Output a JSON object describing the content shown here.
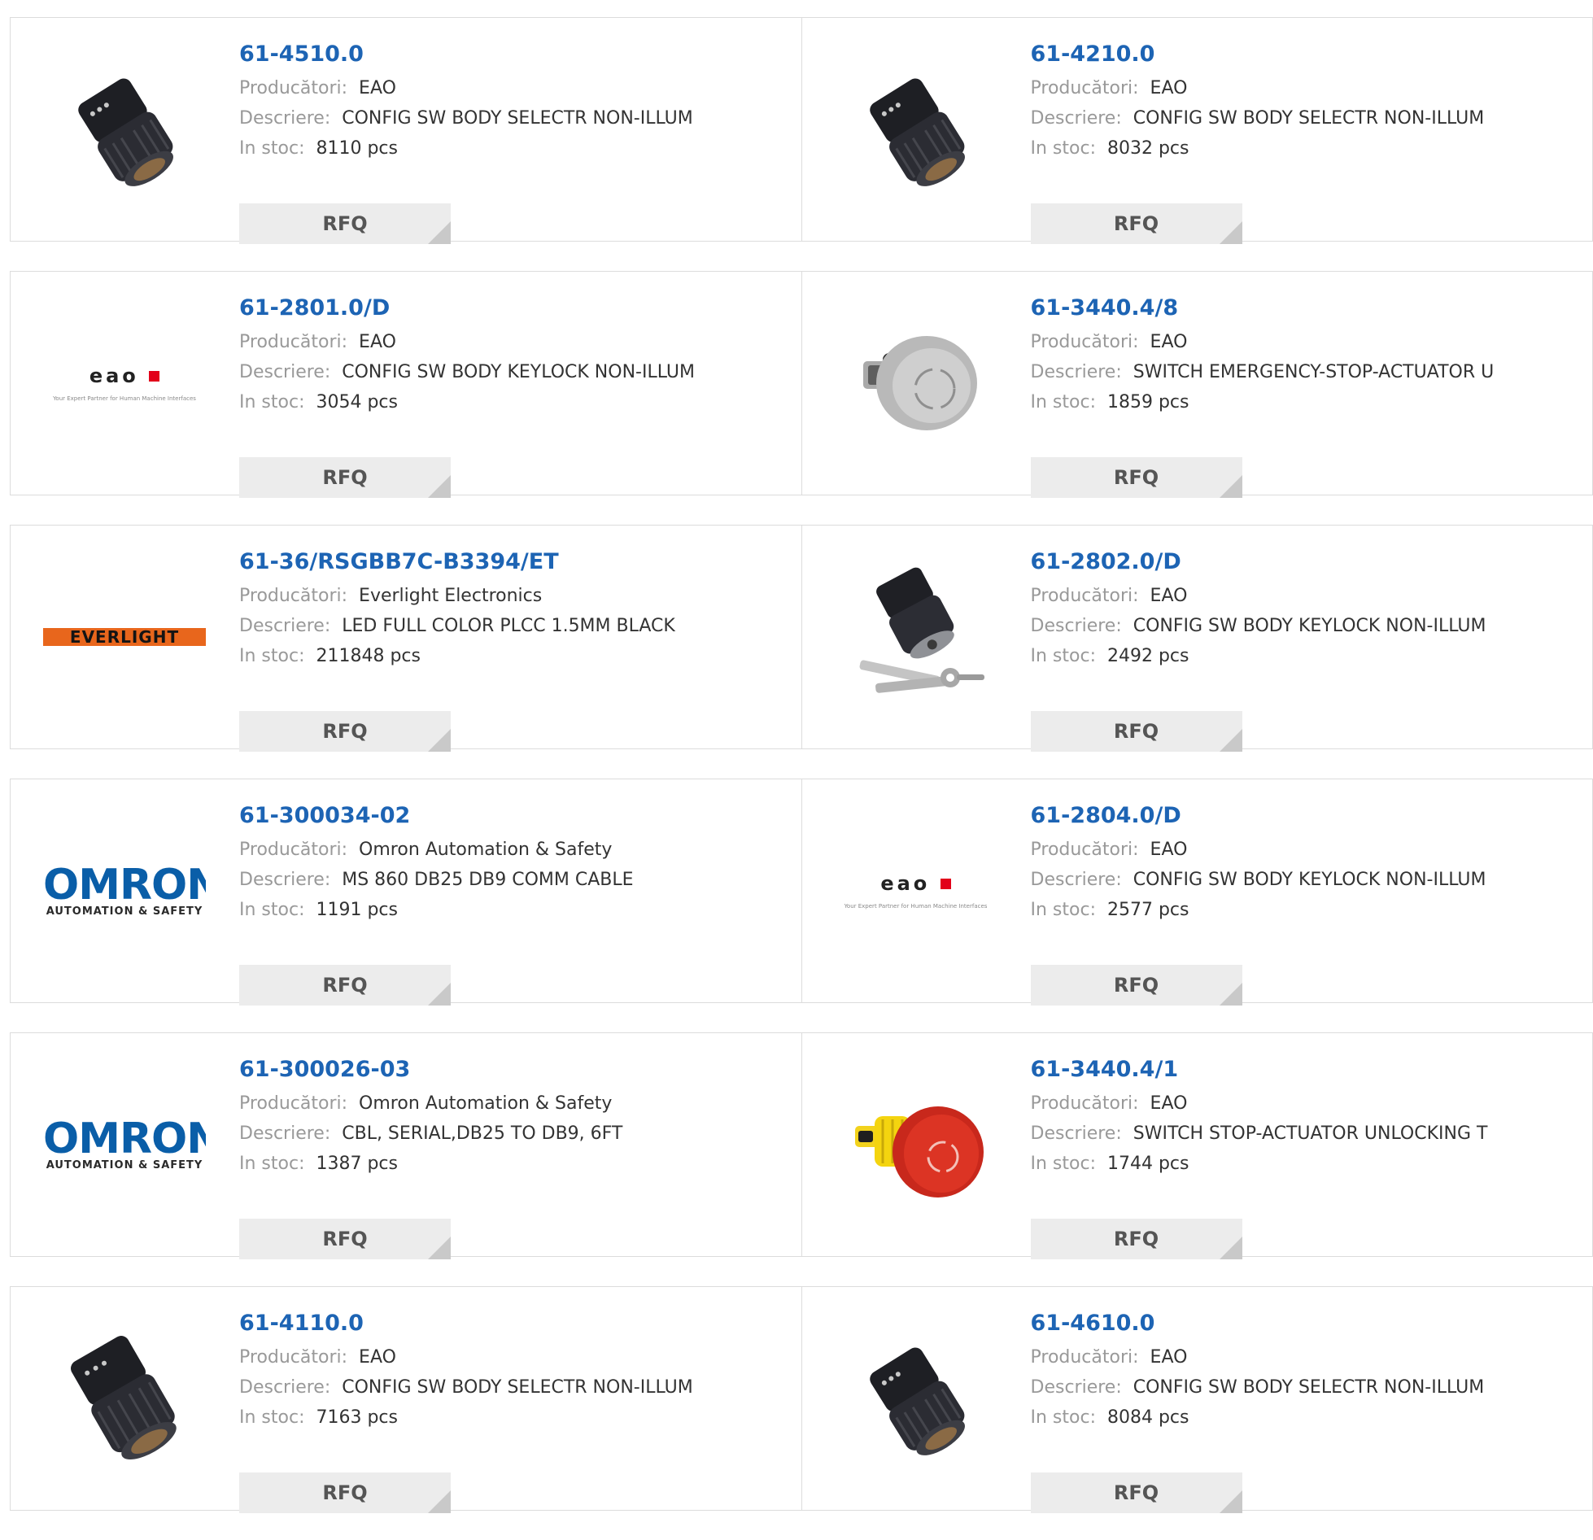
{
  "labels": {
    "manufacturer": "Producători:",
    "description": "Descriere:",
    "stock": "In stoc:",
    "rfq": "RFQ"
  },
  "colors": {
    "link": "#1d64b4",
    "label": "#999999",
    "value": "#333333",
    "button_bg": "#ececec",
    "border": "#dcdcdc"
  },
  "logos": {
    "eao": {
      "word": "eao",
      "tagline": "Your Expert Partner for Human Machine Interfaces"
    },
    "omron": {
      "word": "OMRON",
      "sub": "AUTOMATION & SAFETY"
    },
    "everlight": {
      "word": "EVERLIGHT"
    }
  },
  "products": [
    {
      "part": "61-4510.0",
      "manufacturer": "EAO",
      "description": "CONFIG SW BODY SELECTR NON-ILLUM",
      "stock": "8110 pcs",
      "image": "selector-switch-body-photo"
    },
    {
      "part": "61-4210.0",
      "manufacturer": "EAO",
      "description": "CONFIG SW BODY SELECTR NON-ILLUM",
      "stock": "8032 pcs",
      "image": "selector-switch-body-photo"
    },
    {
      "part": "61-2801.0/D",
      "manufacturer": "EAO",
      "description": "CONFIG SW BODY KEYLOCK NON-ILLUM",
      "stock": "3054 pcs",
      "image": "eao-logo"
    },
    {
      "part": "61-3440.4/8",
      "manufacturer": "EAO",
      "description": "SWITCH EMERGENCY-STOP-ACTUATOR U",
      "stock": "1859 pcs",
      "image": "grey-stop-actuator-photo"
    },
    {
      "part": "61-36/RSGBB7C-B3394/ET",
      "manufacturer": "Everlight Electronics",
      "description": "LED FULL COLOR PLCC 1.5MM BLACK",
      "stock": "211848 pcs",
      "image": "everlight-logo"
    },
    {
      "part": "61-2802.0/D",
      "manufacturer": "EAO",
      "description": "CONFIG SW BODY KEYLOCK NON-ILLUM",
      "stock": "2492 pcs",
      "image": "keylock-with-keys-photo"
    },
    {
      "part": "61-300034-02",
      "manufacturer": "Omron Automation & Safety",
      "description": "MS 860 DB25 DB9 COMM CABLE",
      "stock": "1191 pcs",
      "image": "omron-logo"
    },
    {
      "part": "61-2804.0/D",
      "manufacturer": "EAO",
      "description": "CONFIG SW BODY KEYLOCK NON-ILLUM",
      "stock": "2577 pcs",
      "image": "eao-logo"
    },
    {
      "part": "61-300026-03",
      "manufacturer": "Omron Automation & Safety",
      "description": "CBL, SERIAL,DB25 TO DB9, 6FT",
      "stock": "1387 pcs",
      "image": "omron-logo"
    },
    {
      "part": "61-3440.4/1",
      "manufacturer": "EAO",
      "description": "SWITCH STOP-ACTUATOR UNLOCKING T",
      "stock": "1744 pcs",
      "image": "red-stop-actuator-photo"
    },
    {
      "part": "61-4110.0",
      "manufacturer": "EAO",
      "description": "CONFIG SW BODY SELECTR NON-ILLUM",
      "stock": "7163 pcs",
      "image": "selector-switch-body-photo"
    },
    {
      "part": "61-4610.0",
      "manufacturer": "EAO",
      "description": "CONFIG SW BODY SELECTR NON-ILLUM",
      "stock": "8084 pcs",
      "image": "selector-switch-body-photo"
    }
  ]
}
